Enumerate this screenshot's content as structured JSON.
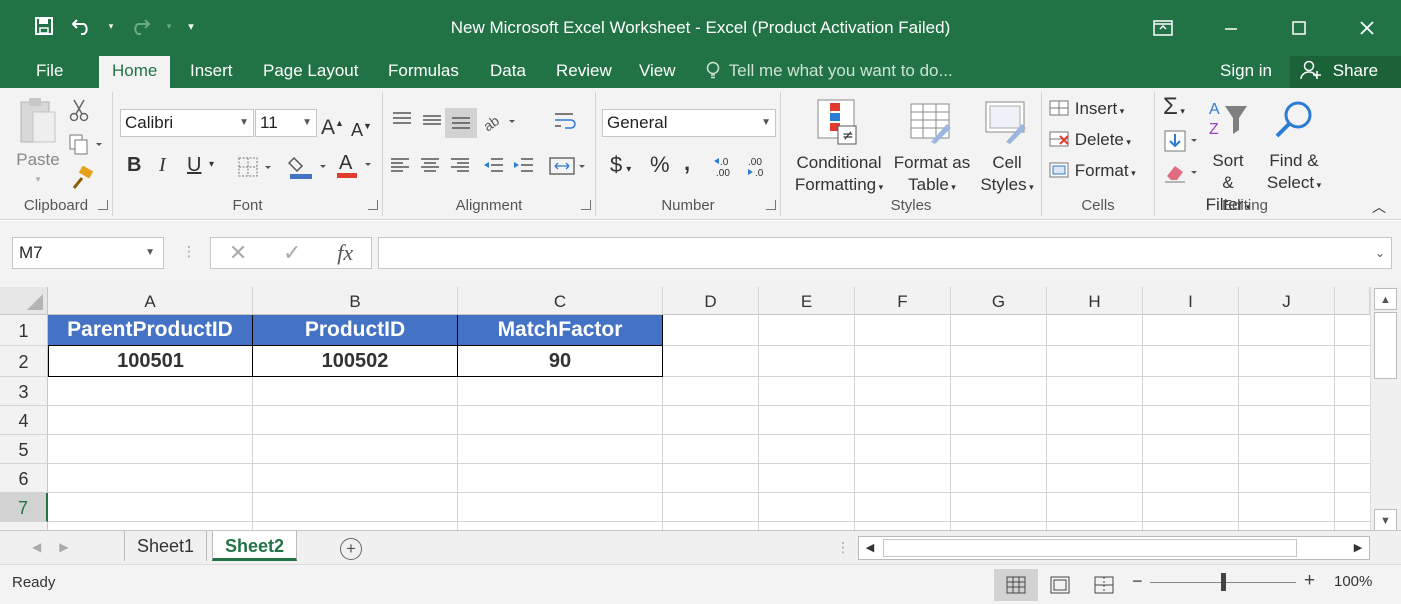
{
  "window": {
    "title": "New Microsoft Excel Worksheet - Excel (Product Activation Failed)"
  },
  "ribbon_tabs": [
    "File",
    "Home",
    "Insert",
    "Page Layout",
    "Formulas",
    "Data",
    "Review",
    "View"
  ],
  "active_tab": "Home",
  "tell_me": "Tell me what you want to do...",
  "sign_in": "Sign in",
  "share": "Share",
  "ribbon": {
    "clipboard": {
      "label": "Clipboard",
      "paste": "Paste"
    },
    "font": {
      "label": "Font",
      "name": "Calibri",
      "size": "11",
      "bold": "B",
      "italic": "I",
      "underline": "U"
    },
    "alignment": {
      "label": "Alignment"
    },
    "number": {
      "label": "Number",
      "format": "General",
      "currency": "$",
      "percent": "%",
      "comma": ",",
      "inc_dec": "←.0\n.00",
      "dec_dec": ".00\n→.0"
    },
    "styles": {
      "label": "Styles",
      "conditional": [
        "Conditional",
        "Formatting"
      ],
      "format_table": [
        "Format as",
        "Table"
      ],
      "cell_styles": [
        "Cell",
        "Styles"
      ]
    },
    "cells": {
      "label": "Cells",
      "insert": "Insert",
      "delete": "Delete",
      "format": "Format"
    },
    "editing": {
      "label": "Editing",
      "sort": [
        "Sort &",
        "Filter"
      ],
      "find": [
        "Find &",
        "Select"
      ]
    }
  },
  "formula_bar": {
    "name_box": "M7",
    "fx": "fx",
    "value": ""
  },
  "columns": [
    "A",
    "B",
    "C",
    "D",
    "E",
    "F",
    "G",
    "H",
    "I",
    "J"
  ],
  "rows": [
    "1",
    "2",
    "3",
    "4",
    "5",
    "6",
    "7"
  ],
  "selected_row": "7",
  "table": {
    "headers": [
      "ParentProductID",
      "ProductID",
      "MatchFactor"
    ],
    "rows": [
      [
        "100501",
        "100502",
        "90"
      ]
    ],
    "header_color": "#4472c4"
  },
  "sheets": [
    "Sheet1",
    "Sheet2"
  ],
  "active_sheet": "Sheet2",
  "status": {
    "ready": "Ready",
    "zoom": "100%"
  },
  "colors": {
    "accent": "#217346"
  }
}
